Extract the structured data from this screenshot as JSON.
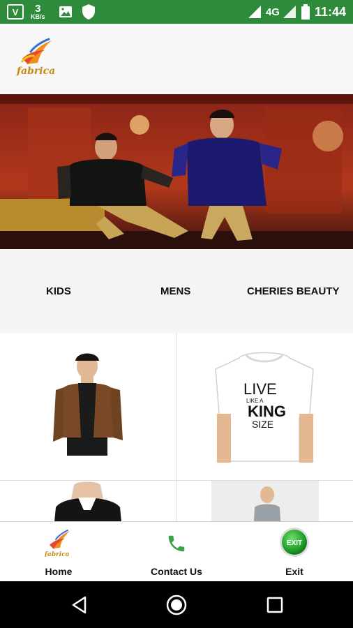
{
  "status_bar": {
    "net_speed_value": "3",
    "net_speed_unit": "KB/s",
    "network_type": "4G",
    "time": "11:44",
    "app_icon_glyph": "V",
    "icons": [
      "app-icon",
      "photo-icon",
      "shield-icon",
      "signal-icon",
      "battery-icon"
    ]
  },
  "header": {
    "logo_text": "fabrica"
  },
  "categories": [
    "KIDS",
    "MENS",
    "CHERIES BEAUTY"
  ],
  "products": [
    {
      "name": "brown-leather-jacket"
    },
    {
      "name": "live-king-size-tshirt",
      "print_line1": "LIVE",
      "print_line2": "LIKE A",
      "print_line3": "KING",
      "print_line4": "SIZE"
    },
    {
      "name": "black-blazer"
    },
    {
      "name": "grey-shirt"
    }
  ],
  "bottom_nav": {
    "home_label": "Home",
    "home_logo_text": "fabrica",
    "contact_label": "Contact Us",
    "exit_label": "Exit",
    "exit_badge": "EXIT"
  },
  "colors": {
    "status_bar": "#2e8b3c",
    "phone_icon": "#3aa04a",
    "exit_button": "#1f9d2a"
  }
}
